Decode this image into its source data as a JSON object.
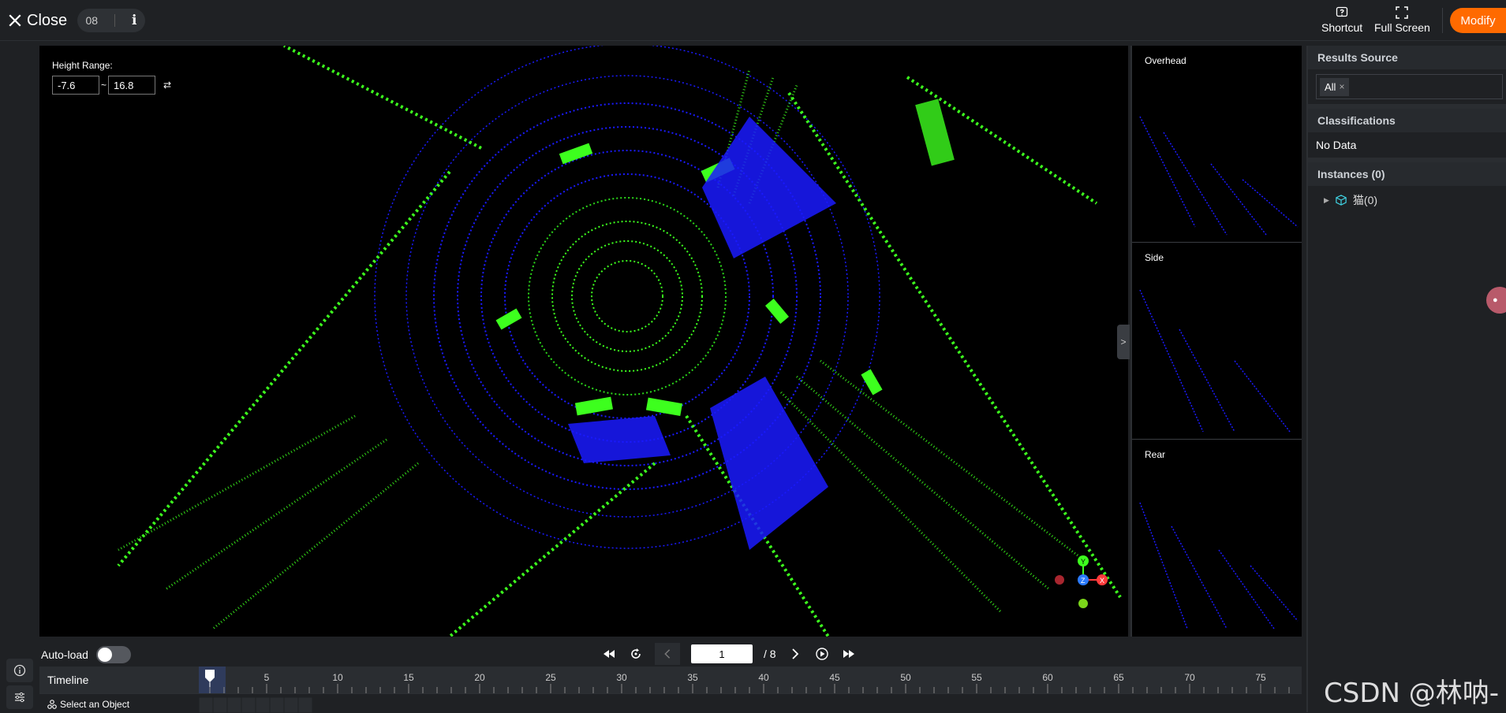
{
  "topbar": {
    "close_label": "Close",
    "frame_id": "08",
    "shortcut_label": "Shortcut",
    "fullscreen_label": "Full Screen",
    "modify_label": "Modify"
  },
  "viewer": {
    "height_range_label": "Height Range:",
    "height_min": "-7.6",
    "height_max": "16.8",
    "tilde": "~",
    "axes": {
      "y": "Y",
      "z": "Z",
      "x": "X"
    }
  },
  "views": {
    "overhead": "Overhead",
    "side": "Side",
    "rear": "Rear"
  },
  "right_panel": {
    "results_source_title": "Results Source",
    "results_source_tag": "All",
    "classifications_title": "Classifications",
    "classifications_empty": "No Data",
    "instances_title": "Instances (0)",
    "instance_item": "猫(0)"
  },
  "bottom": {
    "autoload_label": "Auto-load",
    "current_page": "1",
    "total_pages": "/ 8",
    "timeline_label": "Timeline",
    "select_object_label": "Select an Object",
    "tick_labels": [
      "5",
      "10",
      "15",
      "20",
      "25",
      "30",
      "35",
      "40",
      "45",
      "50",
      "55",
      "60",
      "65",
      "70",
      "75"
    ]
  },
  "watermark": "CSDN @林呐-",
  "colors": {
    "accent": "#ff6a00",
    "cloud_green": "#3dff1e",
    "cloud_blue": "#1a1aff"
  },
  "icons": [
    "close-icon",
    "info-icon",
    "shortcut-icon",
    "fullscreen-icon",
    "info-circle-icon",
    "settings-sliders-icon",
    "rewind-icon",
    "replay-icon",
    "prev-icon",
    "next-icon",
    "play-icon",
    "fast-forward-icon",
    "cube-icon",
    "chevron-right-icon"
  ]
}
